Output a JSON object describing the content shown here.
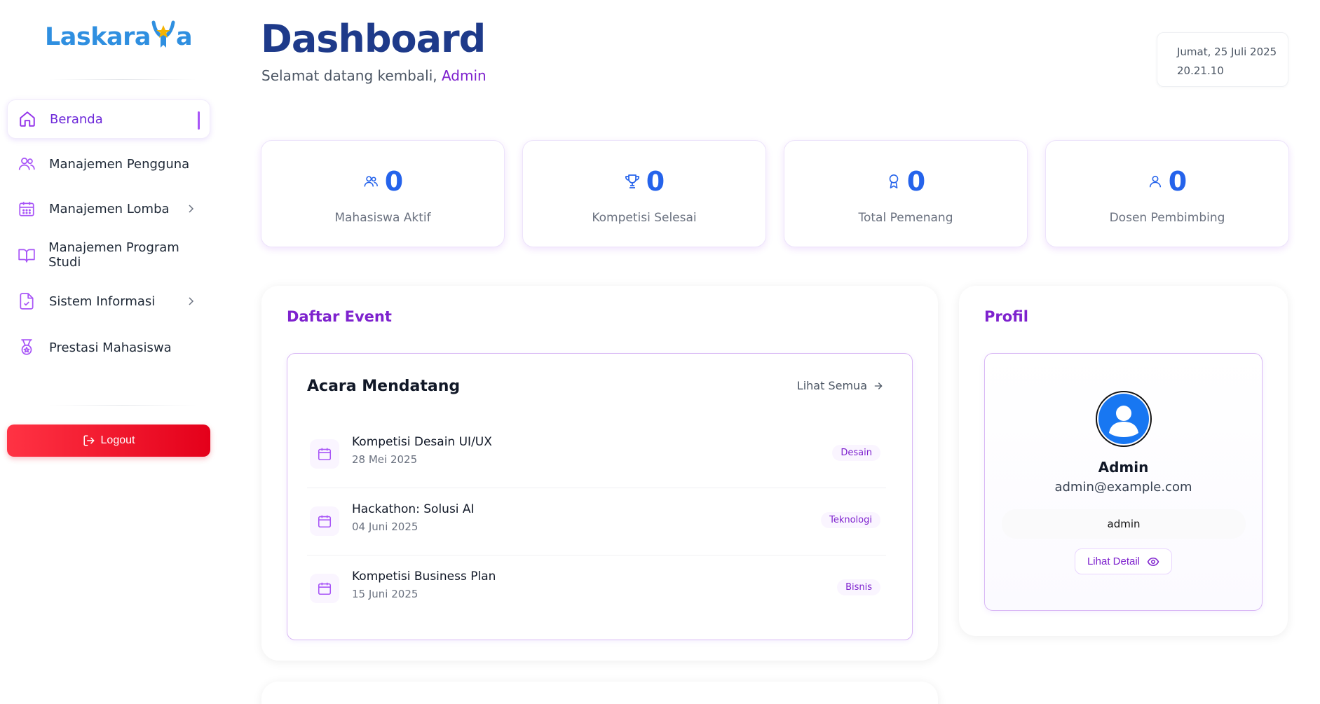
{
  "brand": {
    "name_part1": "Laskara",
    "name_part2": "a"
  },
  "sidebar": {
    "items": [
      {
        "label": "Beranda",
        "icon": "home-icon",
        "active": true
      },
      {
        "label": "Manajemen Pengguna",
        "icon": "users-icon"
      },
      {
        "label": "Manajemen Lomba",
        "icon": "calendar-icon",
        "has_children": true
      },
      {
        "label": "Manajemen Program Studi",
        "icon": "book-icon"
      },
      {
        "label": "Sistem Informasi",
        "icon": "file-check-icon",
        "has_children": true
      },
      {
        "label": "Prestasi Mahasiswa",
        "icon": "medal-icon"
      }
    ],
    "logout_label": "Logout"
  },
  "header": {
    "title": "Dashboard",
    "welcome_prefix": "Selamat datang kembali,",
    "welcome_user": "Admin",
    "date": "Jumat, 25 Juli 2025",
    "time": "20.21.10"
  },
  "stats": [
    {
      "value": "0",
      "label": "Mahasiswa Aktif",
      "icon": "users-icon"
    },
    {
      "value": "0",
      "label": "Kompetisi Selesai",
      "icon": "trophy-icon"
    },
    {
      "value": "0",
      "label": "Total Pemenang",
      "icon": "award-icon"
    },
    {
      "value": "0",
      "label": "Dosen Pembimbing",
      "icon": "user-icon"
    }
  ],
  "events": {
    "panel_title": "Daftar Event",
    "section_title": "Acara Mendatang",
    "see_all": "Lihat Semua",
    "items": [
      {
        "name": "Kompetisi Desain UI/UX",
        "date": "28 Mei 2025",
        "tag": "Desain"
      },
      {
        "name": "Hackathon: Solusi AI",
        "date": "04 Juni 2025",
        "tag": "Teknologi"
      },
      {
        "name": "Kompetisi Business Plan",
        "date": "15 Juni 2025",
        "tag": "Bisnis"
      }
    ]
  },
  "profile": {
    "panel_title": "Profil",
    "name": "Admin",
    "email": "admin@example.com",
    "role": "admin",
    "detail_label": "Lihat Detail"
  },
  "colors": {
    "accent": "#7e22ce",
    "primary": "#2563eb",
    "title": "#1e3a8a",
    "danger": "#e4001a"
  }
}
